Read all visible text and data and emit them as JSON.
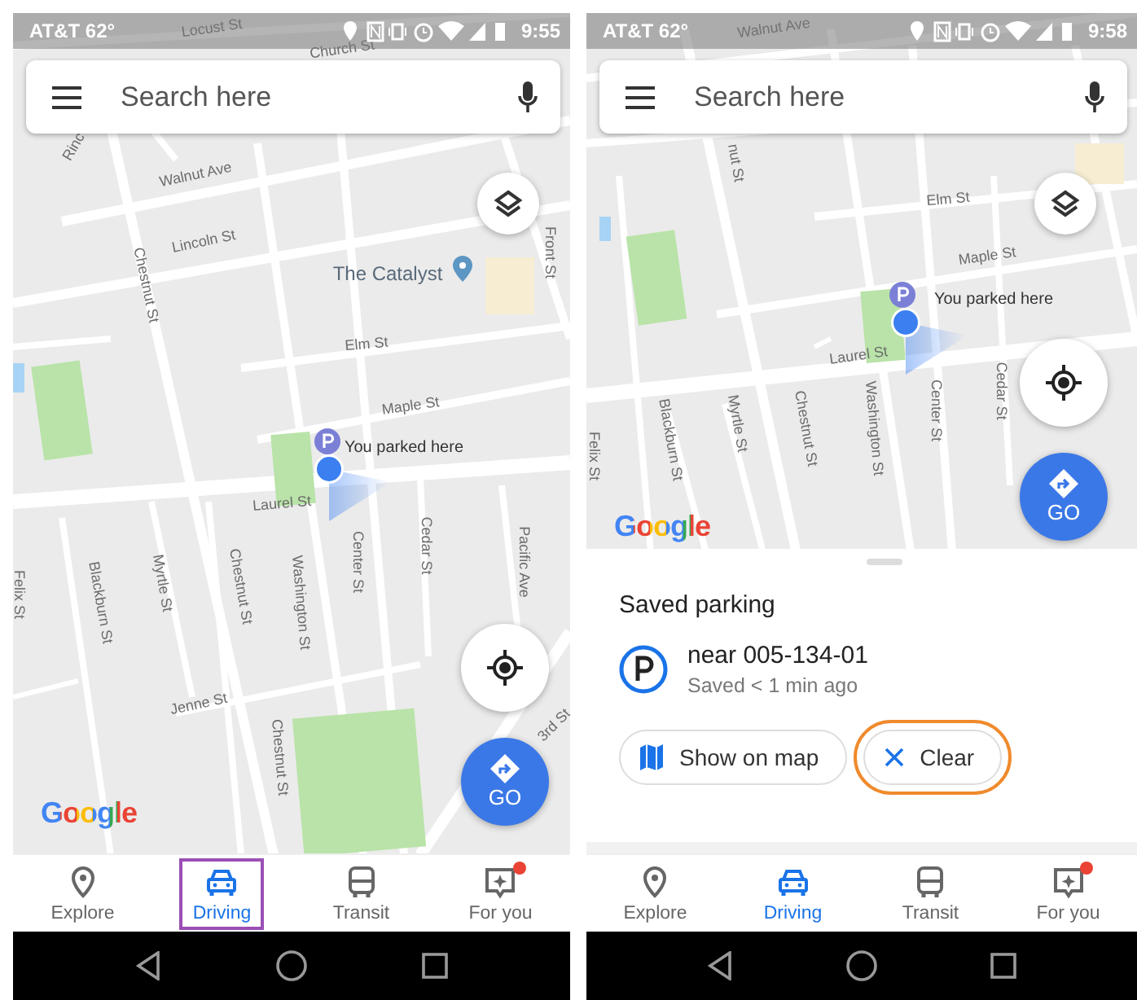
{
  "screens": [
    {
      "status_bar": {
        "carrier": "AT&T 62°",
        "time": "9:55"
      },
      "search": {
        "placeholder": "Search here"
      },
      "map": {
        "labels": [
          {
            "text": "Locust St",
            "kind": "street"
          },
          {
            "text": "Church St",
            "kind": "street"
          },
          {
            "text": "Rinc",
            "kind": "street"
          },
          {
            "text": "Walnut Ave",
            "kind": "street"
          },
          {
            "text": "Lincoln St",
            "kind": "street"
          },
          {
            "text": "Chestnut St",
            "kind": "street"
          },
          {
            "text": "The Catalyst",
            "kind": "poi"
          },
          {
            "text": "Front St",
            "kind": "street"
          },
          {
            "text": "Elm St",
            "kind": "street"
          },
          {
            "text": "Maple St",
            "kind": "street"
          },
          {
            "text": "You parked here",
            "kind": "parked"
          },
          {
            "text": "Laurel St",
            "kind": "street"
          },
          {
            "text": "Felix St",
            "kind": "street"
          },
          {
            "text": "Blackburn St",
            "kind": "street"
          },
          {
            "text": "Myrtle St",
            "kind": "street"
          },
          {
            "text": "Chestnut St",
            "kind": "street"
          },
          {
            "text": "Washington St",
            "kind": "street"
          },
          {
            "text": "Center St",
            "kind": "street"
          },
          {
            "text": "Cedar St",
            "kind": "street"
          },
          {
            "text": "Pacific Ave",
            "kind": "street"
          },
          {
            "text": "Jenne St",
            "kind": "street"
          },
          {
            "text": "Chestnut St",
            "kind": "street"
          },
          {
            "text": "3rd St",
            "kind": "street"
          }
        ],
        "logo": "Google"
      },
      "go_button": {
        "label": "GO"
      },
      "tabs": [
        {
          "label": "Explore",
          "kind": "explore",
          "selected": false,
          "highlighted": false,
          "badge": false
        },
        {
          "label": "Driving",
          "kind": "driving",
          "selected": true,
          "highlighted": true,
          "badge": false
        },
        {
          "label": "Transit",
          "kind": "transit",
          "selected": false,
          "highlighted": false,
          "badge": false
        },
        {
          "label": "For you",
          "kind": "foryou",
          "selected": false,
          "highlighted": false,
          "badge": true
        }
      ]
    },
    {
      "status_bar": {
        "carrier": "AT&T 62°",
        "time": "9:58"
      },
      "search": {
        "placeholder": "Search here"
      },
      "map": {
        "labels": [
          {
            "text": "Walnut Ave",
            "kind": "street"
          },
          {
            "text": "nut St",
            "kind": "street"
          },
          {
            "text": "Elm St",
            "kind": "street"
          },
          {
            "text": "Maple St",
            "kind": "street"
          },
          {
            "text": "You parked here",
            "kind": "parked"
          },
          {
            "text": "Laurel St",
            "kind": "street"
          },
          {
            "text": "Felix St",
            "kind": "street"
          },
          {
            "text": "Blackburn St",
            "kind": "street"
          },
          {
            "text": "Myrtle St",
            "kind": "street"
          },
          {
            "text": "Chestnut St",
            "kind": "street"
          },
          {
            "text": "Washington St",
            "kind": "street"
          },
          {
            "text": "Center St",
            "kind": "street"
          },
          {
            "text": "Cedar St",
            "kind": "street"
          }
        ],
        "logo": "Google"
      },
      "go_button": {
        "label": "GO"
      },
      "sheet": {
        "title": "Saved parking",
        "place": "near 005-134-01",
        "saved": "Saved < 1 min ago",
        "buttons": [
          {
            "label": "Show on map",
            "kind": "map",
            "highlighted": false
          },
          {
            "label": "Clear",
            "kind": "clear",
            "highlighted": true
          }
        ]
      },
      "tabs": [
        {
          "label": "Explore",
          "kind": "explore",
          "selected": false,
          "highlighted": false,
          "badge": false
        },
        {
          "label": "Driving",
          "kind": "driving",
          "selected": true,
          "highlighted": false,
          "badge": false
        },
        {
          "label": "Transit",
          "kind": "transit",
          "selected": false,
          "highlighted": false,
          "badge": false
        },
        {
          "label": "For you",
          "kind": "foryou",
          "selected": false,
          "highlighted": false,
          "badge": true
        }
      ]
    }
  ]
}
